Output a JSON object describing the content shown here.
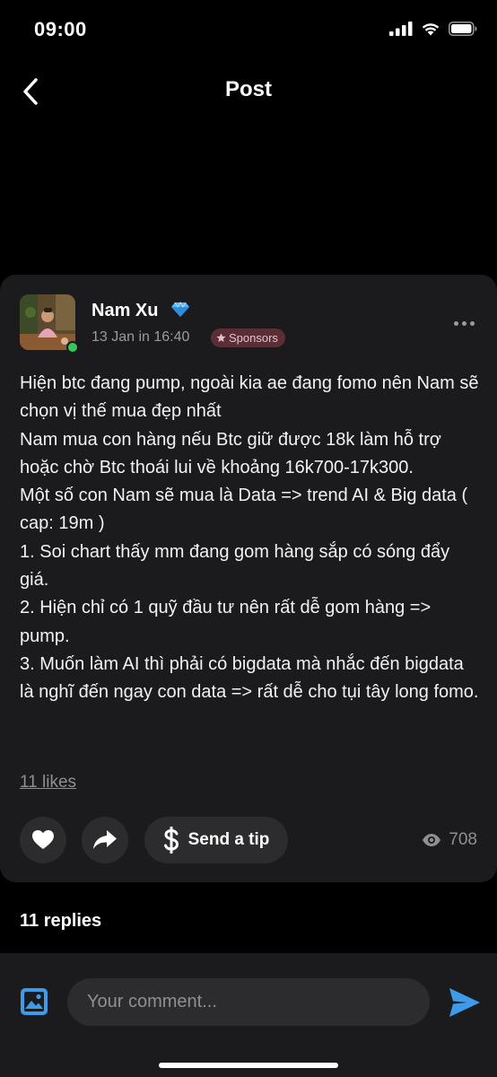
{
  "status_bar": {
    "time": "09:00"
  },
  "nav": {
    "title": "Post"
  },
  "post": {
    "author": "Nam Xu",
    "meta": "13 Jan in 16:40",
    "badge": "Sponsors",
    "body": [
      "Hiện btc đang pump, ngoài kia ae đang fomo nên Nam sẽ chọn vị thế mua đẹp nhất",
      "Nam mua con hàng nếu Btc giữ được 18k làm hỗ trợ hoặc chờ Btc thoái lui về khoảng 16k700-17k300.",
      "Một số con Nam sẽ mua là Data => trend AI & Big data ( cap: 19m )",
      "1. Soi chart thấy mm đang gom hàng sắp có sóng đẩy giá.",
      "2. Hiện chỉ có 1 quỹ đầu tư nên rất dễ gom hàng => pump.",
      "3. Muốn làm AI thì phải có bigdata mà nhắc đến bigdata là nghĩ đến ngay con data => rất dễ cho tụi tây long fomo."
    ],
    "likes": "11 likes",
    "tip_label": "Send a tip",
    "views": "708"
  },
  "replies_heading": "11 replies",
  "comment": {
    "placeholder": "Your comment..."
  },
  "icons": {
    "back": "chevron-left-icon",
    "verified": "diamond-icon",
    "more": "more-horizontal-icon",
    "like": "heart-icon",
    "share": "share-arrow-icon",
    "tip": "dollar-icon",
    "views": "eye-icon",
    "image": "image-icon",
    "send": "send-icon"
  },
  "colors": {
    "background": "#000000",
    "card": "#1b1b1e",
    "button": "#2c2c2f",
    "accent": "#3e9be9",
    "badge": "#5b2e36",
    "online": "#34c759"
  }
}
